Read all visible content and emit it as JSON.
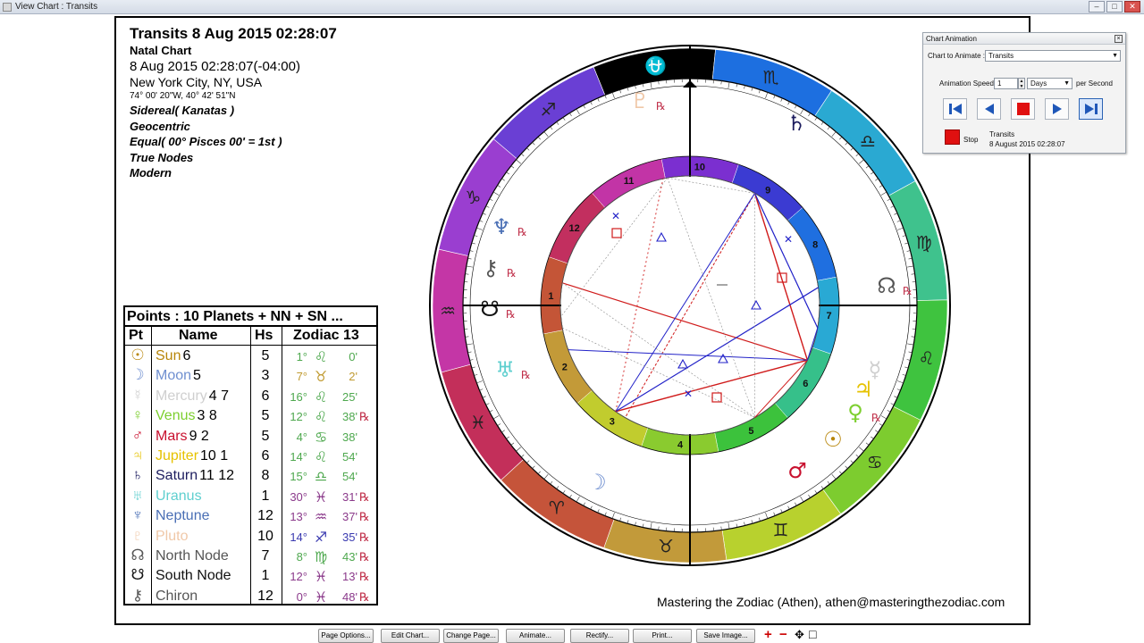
{
  "window": {
    "title": "View Chart : Transits",
    "buttons": [
      "–",
      "□",
      "✕"
    ]
  },
  "header": {
    "title": "Transits 8 Aug 2015 02:28:07",
    "subtitle": "Natal Chart",
    "datetime": "8 Aug 2015 02:28:07(-04:00)",
    "location": "New York City, NY, USA",
    "coordinates": "74° 00' 20\"W, 40° 42' 51\"N",
    "options": [
      "Sidereal( Kanatas )",
      "Geocentric",
      "Equal( 00° Pisces 00' = 1st )",
      "True Nodes",
      "Modern"
    ]
  },
  "points_table": {
    "title": "Points : 10 Planets + NN + SN ...",
    "headers": {
      "pt": "Pt",
      "name": "Name",
      "hs": "Hs",
      "zodiac": "Zodiac 13"
    },
    "rows": [
      {
        "glyph": "☉",
        "name": "Sun",
        "rules": "6",
        "house": "5",
        "deg": "1°",
        "sign": "♌",
        "min": "0'",
        "rx": "",
        "color": "#b8860b",
        "sign_color": "#4ea84e"
      },
      {
        "glyph": "☽",
        "name": "Moon",
        "rules": "5",
        "house": "3",
        "deg": "7°",
        "sign": "♉",
        "min": "2'",
        "rx": "",
        "color": "#6f8fd0",
        "sign_color": "#c09a30"
      },
      {
        "glyph": "☿",
        "name": "Mercury",
        "rules": "4 7",
        "house": "6",
        "deg": "16°",
        "sign": "♌",
        "min": "25'",
        "rx": "",
        "color": "#cfcfcf",
        "sign_color": "#4ea84e"
      },
      {
        "glyph": "♀",
        "name": "Venus",
        "rules": "3  8",
        "house": "5",
        "deg": "12°",
        "sign": "♌",
        "min": "38'",
        "rx": "℞",
        "color": "#7dcf2f",
        "sign_color": "#4ea84e"
      },
      {
        "glyph": "♂",
        "name": "Mars",
        "rules": "9  2",
        "house": "5",
        "deg": "4°",
        "sign": "♋",
        "min": "38'",
        "rx": "",
        "color": "#c8102e",
        "sign_color": "#4ea84e"
      },
      {
        "glyph": "♃",
        "name": "Jupiter",
        "rules": "10  1",
        "house": "6",
        "deg": "14°",
        "sign": "♌",
        "min": "54'",
        "rx": "",
        "color": "#e6c200",
        "sign_color": "#4ea84e"
      },
      {
        "glyph": "♄",
        "name": "Saturn",
        "rules": "11 12",
        "house": "8",
        "deg": "15°",
        "sign": "♎",
        "min": "54'",
        "rx": "",
        "color": "#1c1c5e",
        "sign_color": "#4ea84e"
      },
      {
        "glyph": "♅",
        "name": "Uranus",
        "rules": "",
        "house": "1",
        "deg": "30°",
        "sign": "♓",
        "min": "31'",
        "rx": "℞",
        "color": "#5fcfcf",
        "sign_color": "#8b3a8b"
      },
      {
        "glyph": "♆",
        "name": "Neptune",
        "rules": "",
        "house": "12",
        "deg": "13°",
        "sign": "♒",
        "min": "37'",
        "rx": "℞",
        "color": "#4a6fb5",
        "sign_color": "#8b3a8b"
      },
      {
        "glyph": "♇",
        "name": "Pluto",
        "rules": "",
        "house": "10",
        "deg": "14°",
        "sign": "♐",
        "min": "35'",
        "rx": "℞",
        "color": "#f0c8a8",
        "sign_color": "#3a3ab0"
      },
      {
        "glyph": "☊",
        "name": "North Node",
        "rules": "",
        "house": "7",
        "deg": "8°",
        "sign": "♍",
        "min": "43'",
        "rx": "℞",
        "color": "#555555",
        "sign_color": "#4ea84e"
      },
      {
        "glyph": "☋",
        "name": "South Node",
        "rules": "",
        "house": "1",
        "deg": "12°",
        "sign": "♓",
        "min": "13'",
        "rx": "℞",
        "color": "#111111",
        "sign_color": "#8b3a8b"
      },
      {
        "glyph": "⚷",
        "name": "Chiron",
        "rules": "",
        "house": "12",
        "deg": "0°",
        "sign": "♓",
        "min": "48'",
        "rx": "℞",
        "color": "#555555",
        "sign_color": "#8b3a8b"
      }
    ]
  },
  "wheel": {
    "signs": [
      {
        "glyph": "⛎",
        "color": "#000000"
      },
      {
        "glyph": "♏",
        "color": "#1d6fe0"
      },
      {
        "glyph": "♎",
        "color": "#2aa9d2"
      },
      {
        "glyph": "♍",
        "color": "#3fc28d"
      },
      {
        "glyph": "♌",
        "color": "#3fc33f"
      },
      {
        "glyph": "♋",
        "color": "#7dcc2f"
      },
      {
        "glyph": "♊",
        "color": "#b8d12e"
      },
      {
        "glyph": "♉",
        "color": "#c29a3a"
      },
      {
        "glyph": "♈",
        "color": "#c5543a"
      },
      {
        "glyph": "♓",
        "color": "#c32f5a"
      },
      {
        "glyph": "♒",
        "color": "#c436a6"
      },
      {
        "glyph": "♑",
        "color": "#9a3ed0"
      },
      {
        "glyph": "♐",
        "color": "#6a3fd4"
      }
    ],
    "houses": [
      "1",
      "2",
      "3",
      "4",
      "5",
      "6",
      "7",
      "8",
      "9",
      "10",
      "11",
      "12"
    ],
    "outer_planets": [
      {
        "glyph": "♇",
        "rx": "℞",
        "color": "#f0c8a8"
      },
      {
        "glyph": "♄",
        "rx": "",
        "color": "#1c1c5e"
      },
      {
        "glyph": "♆",
        "rx": "℞",
        "color": "#4a6fb5"
      },
      {
        "glyph": "⚷",
        "rx": "℞",
        "color": "#555555"
      },
      {
        "glyph": "☋",
        "rx": "℞",
        "color": "#111111"
      },
      {
        "glyph": "♅",
        "rx": "℞",
        "color": "#5fcfcf"
      },
      {
        "glyph": "☽",
        "rx": "",
        "color": "#6f8fd0"
      },
      {
        "glyph": "☊",
        "rx": "℞",
        "color": "#555555"
      },
      {
        "glyph": "☿",
        "rx": "",
        "color": "#cfcfcf"
      },
      {
        "glyph": "♃",
        "rx": "",
        "color": "#e6c200"
      },
      {
        "glyph": "♀",
        "rx": "℞",
        "color": "#7dcf2f"
      },
      {
        "glyph": "☉",
        "rx": "",
        "color": "#b8860b"
      },
      {
        "glyph": "♂",
        "rx": "",
        "color": "#c8102e"
      }
    ]
  },
  "credit": "Mastering the Zodiac (Athen), athen@masteringthezodiac.com",
  "animation": {
    "title": "Chart Animation",
    "chart_label": "Chart to Animate :",
    "chart_value": "Transits",
    "speed_label": "Animation Speed :",
    "speed_value": "1",
    "unit_value": "Days",
    "per_label": "per Second",
    "stop_label": "Stop",
    "status_name": "Transits",
    "status_date": "8 August 2015 02:28:07"
  },
  "buttons": [
    "Page Options...",
    "Edit Chart...",
    "Change Page...",
    "Animate...",
    "Rectify...",
    "Print...",
    "Save Image..."
  ],
  "zoom_icons": [
    "zoom-in-icon",
    "zoom-out-icon",
    "pan-icon",
    "fit-icon"
  ],
  "zoom_glyphs": [
    "+",
    "−",
    "✥",
    "□"
  ]
}
